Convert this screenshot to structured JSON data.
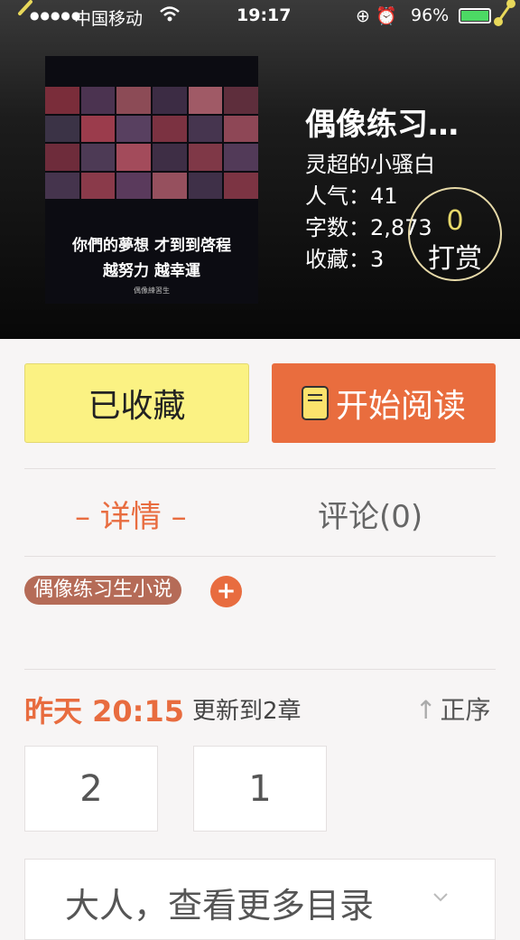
{
  "status_bar": {
    "signal": "●●●●●",
    "carrier": "中国移动",
    "wifi_icon": "wifi-icon",
    "time": "19:17",
    "lock_alarm": "⊕ ⏰",
    "battery": "96%"
  },
  "book": {
    "title": "偶像练习…",
    "author": "灵超的小骚白",
    "popularity": "人气：41",
    "words": "字数：2,873",
    "favorites": "收藏：3",
    "cover_text_line1": "你們的夢想 才到到啓程",
    "cover_text_line2": "越努力 越幸運",
    "cover_small_text": "偶像練習生"
  },
  "tip": {
    "count": "0",
    "label": "打赏"
  },
  "buttons": {
    "favorited": "已收藏",
    "start_reading": "开始阅读"
  },
  "tabs": {
    "detail": "– 详情 –",
    "comments": "评论(0)"
  },
  "tags": [
    "偶像练习生小说"
  ],
  "tag_add": "+",
  "update": {
    "time": "昨天 20:15",
    "text": "更新到2章",
    "order": "正序"
  },
  "chapters": [
    "2",
    "1"
  ],
  "more": {
    "label": "大人，查看更多目录"
  },
  "colors": {
    "accent": "#e86c3f",
    "favorite_bg": "#fbf283",
    "read_bg": "#e96d3e"
  }
}
